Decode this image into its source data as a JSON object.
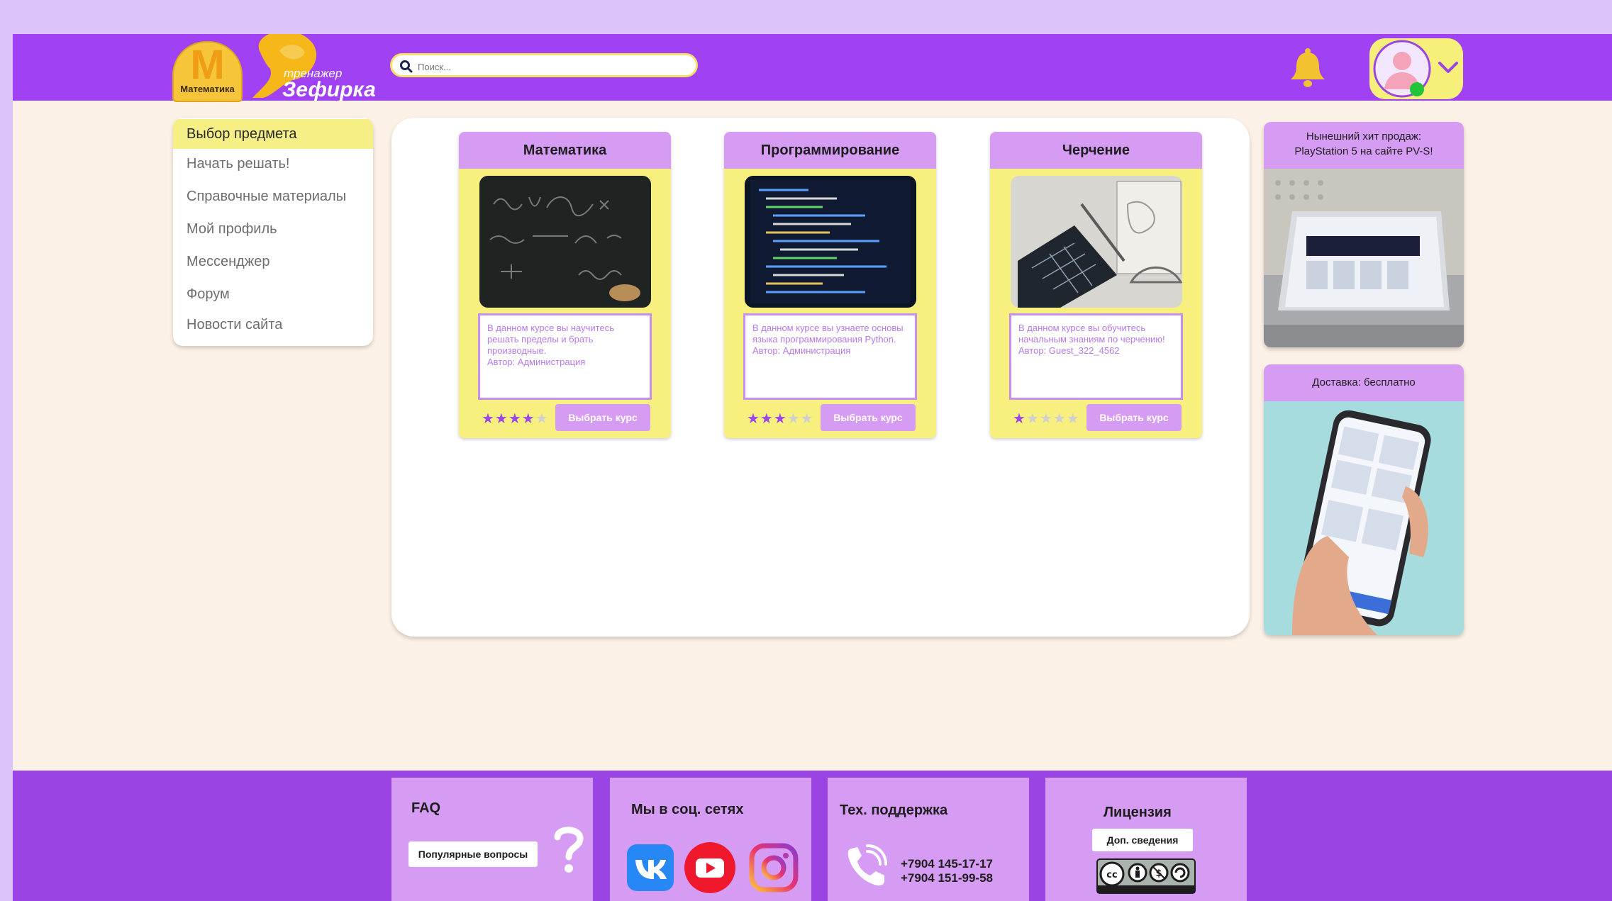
{
  "colors": {
    "header_bg": "#a042f3",
    "footer_bg": "#9a44e4",
    "accent_lilac": "#d69bf3",
    "accent_yellow": "#f8f07e",
    "page_bg": "#fcf1e6",
    "star_on": "#9a46e8"
  },
  "header": {
    "logo_letter": "M",
    "logo_caption": "Математика",
    "brand_small": "тренажер",
    "brand_big": "Зефирка",
    "search_placeholder": "Поиск...",
    "icons": [
      "search-icon",
      "bell-icon",
      "avatar-icon",
      "chevron-down-icon"
    ]
  },
  "sidebar": {
    "items": [
      {
        "label": "Выбор предмета",
        "active": true
      },
      {
        "label": "Начать решать!"
      },
      {
        "label": "Справочные материалы"
      },
      {
        "label": "Мой профиль"
      },
      {
        "label": "Мессенджер"
      },
      {
        "label": "Форум"
      },
      {
        "label": "Новости сайта"
      }
    ]
  },
  "courses": [
    {
      "title": "Математика",
      "description": "В данном курсе вы научитесь решать пределы и брать производные.",
      "author": "Автор: Администрация",
      "rating": 4,
      "rating_max": 5,
      "button": "Выбрать курс"
    },
    {
      "title": "Программирование",
      "description": "В данном курсе вы узнаете основы языка программирования Python.",
      "author": "Автор: Администрация",
      "rating": 3,
      "rating_max": 5,
      "button": "Выбрать курс"
    },
    {
      "title": "Черчение",
      "description": "В данном курсе вы обучитесь начальным знаниям по черчению!",
      "author": "Автор: Guest_322_4562",
      "rating": 1,
      "rating_max": 5,
      "button": "Выбрать курс"
    }
  ],
  "ads": [
    {
      "title_line1": "Нынешний хит продаж:",
      "title_line2": "PlayStation 5 на сайте PV-S!"
    },
    {
      "title": "Доставка: бесплатно"
    }
  ],
  "footer": {
    "faq": {
      "title": "FAQ",
      "button": "Популярные вопросы"
    },
    "social": {
      "title": "Мы в соц. сетях",
      "icons": [
        "vk-icon",
        "youtube-icon",
        "instagram-icon"
      ]
    },
    "support": {
      "title": "Тех. поддержка",
      "phone1": "+7904 145-17-17",
      "phone2": "+7904 151-99-58"
    },
    "license": {
      "title": "Лицензия",
      "button": "Доп. сведения"
    }
  }
}
